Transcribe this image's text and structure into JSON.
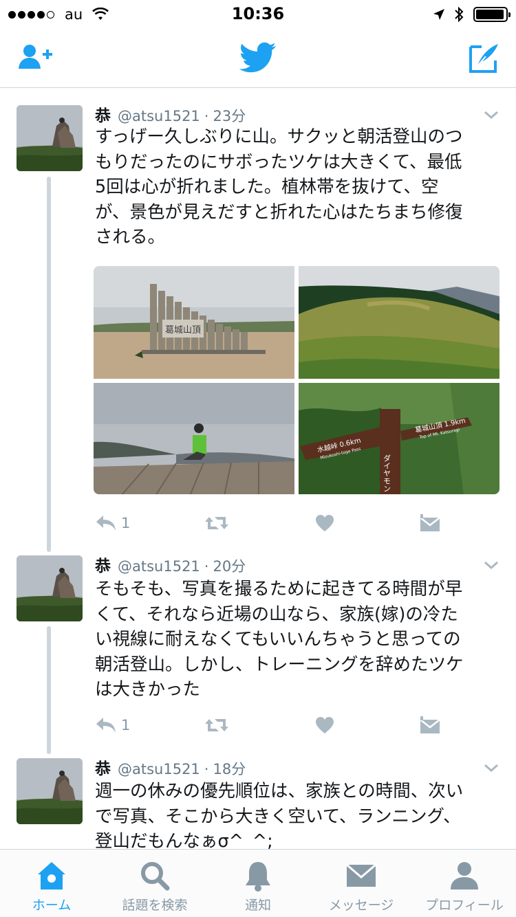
{
  "status_bar": {
    "carrier": "au",
    "time": "10:36",
    "signal_dots": 5,
    "signal_filled": 4,
    "battery_level": 0.95
  },
  "nav": {
    "left_icon": "add-user-icon",
    "center_icon": "twitter-bird-icon",
    "right_icon": "compose-tweet-icon",
    "accent_color": "#1da1f2"
  },
  "tweets": [
    {
      "name": "恭",
      "handle": "@atsu1521",
      "sep": "·",
      "time": "23分",
      "lines": [
        "すっげー久しぶりに山。サクッと朝活登山のつ",
        "もりだったのにサボったツケは大きくて、最低",
        "5回は心が折れました。植林帯を抜けて、空",
        "が、景色が見えだすと折れた心はたちまち修復",
        "される。"
      ],
      "reply_count": "1",
      "media": {
        "sign_text": "葛城山頂",
        "signpost_left": "水越峠 0.6km",
        "signpost_left_sub": "Mizukoshi-toge Pass",
        "signpost_right": "葛城山頂 1.9km",
        "signpost_right_sub": "Top of Mt. Katsuragi",
        "signpost_vertical": "ダイヤモン"
      }
    },
    {
      "name": "恭",
      "handle": "@atsu1521",
      "sep": "·",
      "time": "20分",
      "lines": [
        "そもそも、写真を撮るために起きてる時間が早",
        "くて、それなら近場の山なら、家族(嫁)の冷た",
        "い視線に耐えなくてもいいんちゃうと思っての",
        "朝活登山。しかし、トレーニングを辞めたツケ",
        "は大きかった"
      ],
      "reply_count": "1"
    },
    {
      "name": "恭",
      "handle": "@atsu1521",
      "sep": "·",
      "time": "18分",
      "lines": [
        "週一の休みの優先順位は、家族との時間、次い",
        "で写真、そこから大きく空いて、ランニング、",
        "登山だもんなぁσ^_^;"
      ]
    }
  ],
  "tabbar": {
    "items": [
      {
        "label": "ホーム",
        "icon": "home-icon",
        "active": true
      },
      {
        "label": "話題を検索",
        "icon": "search-icon",
        "active": false
      },
      {
        "label": "通知",
        "icon": "bell-icon",
        "active": false
      },
      {
        "label": "メッセージ",
        "icon": "envelope-icon",
        "active": false
      },
      {
        "label": "プロフィール",
        "icon": "person-icon",
        "active": false
      }
    ]
  }
}
